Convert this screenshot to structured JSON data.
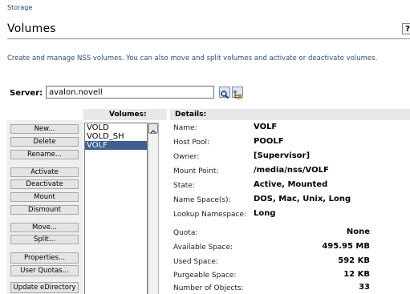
{
  "breadcrumb": "Storage",
  "page_title": "Volumes",
  "help_label": "?",
  "description": "Create and manage NSS volumes. You can also move and split volumes and activate or deactivate volumes.",
  "server": {
    "label": "Server:",
    "value": "avalon.novell"
  },
  "icons": {
    "search": "search-icon",
    "tree": "tree-browse-icon",
    "scroll_up": "chevron-up-icon"
  },
  "columns": {
    "volumes": "Volumes:",
    "details": "Details:"
  },
  "actions": {
    "new": "New...",
    "delete": "Delete",
    "rename": "Rename...",
    "activate": "Activate",
    "deactivate": "Deactivate",
    "mount": "Mount",
    "dismount": "Dismount",
    "move": "Move...",
    "split": "Split...",
    "properties": "Properties...",
    "user_quotas": "User Quotas...",
    "update_edirectory": "Update eDirectory"
  },
  "volumes": [
    {
      "name": "VOLD",
      "selected": false
    },
    {
      "name": "VOLD_SH",
      "selected": false
    },
    {
      "name": "VOLF",
      "selected": true
    }
  ],
  "details": {
    "name": {
      "label": "Name:",
      "value": "VOLF"
    },
    "host_pool": {
      "label": "Host Pool:",
      "value": "POOLF"
    },
    "owner": {
      "label": "Owner:",
      "value": "[Supervisor]"
    },
    "mount_point": {
      "label": "Mount Point:",
      "value": "/media/nss/VOLF"
    },
    "state": {
      "label": "State:",
      "value": "Active, Mounted"
    },
    "name_spaces": {
      "label": "Name Space(s):",
      "value": "DOS, Mac, Unix, Long"
    },
    "lookup_namespace": {
      "label": "Lookup Namespace:",
      "value": "Long"
    },
    "quota": {
      "label": "Quota:",
      "value": "None"
    },
    "available_space": {
      "label": "Available Space:",
      "value": "495.95 MB"
    },
    "used_space": {
      "label": "Used Space:",
      "value": "592 KB"
    },
    "purgeable_space": {
      "label": "Purgeable Space:",
      "value": "12 KB"
    },
    "number_of_objects": {
      "label": "Number of Objects:",
      "value": "33"
    }
  },
  "colors": {
    "selection": "#3f5f8f",
    "heading_blue": "#2c4f7c",
    "column_header_bg": "#e8e8e8"
  }
}
